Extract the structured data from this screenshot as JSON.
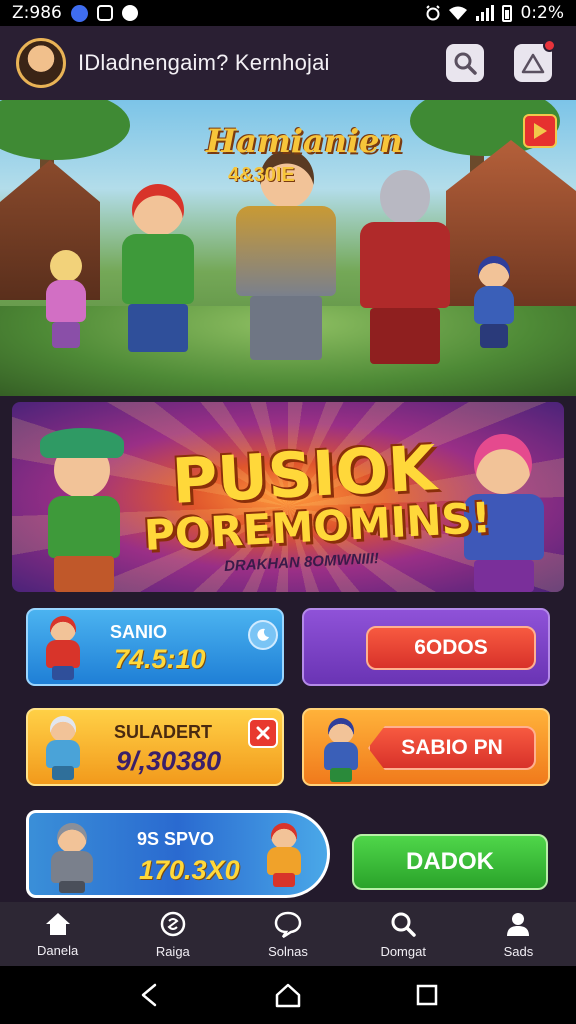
{
  "status_bar": {
    "time": "Z:986",
    "battery_text": "0:2%"
  },
  "header": {
    "title": "IDladnengaim? Kernhojai",
    "search_icon": "search-icon",
    "notification_icon": "triangle-alert-icon"
  },
  "hero": {
    "title": "Hamianien",
    "subtitle": "4&30IE",
    "play_icon": "play-icon"
  },
  "promo": {
    "title_line1": "PUSIOK",
    "title_line2": "POREMOMINS!",
    "subtitle": "DRAKHAN 8OMWNIII!"
  },
  "cards": {
    "c1": {
      "label": "SANIO",
      "value": "74.5:10"
    },
    "c2": {
      "button": "6ODOS"
    },
    "c3": {
      "label": "SULADERT",
      "value": "9/,30380"
    },
    "c4": {
      "button": "SABIO PN"
    },
    "c5": {
      "label": "9S SPVO",
      "value": "170.3X0"
    },
    "c6": {
      "button": "DADOK"
    }
  },
  "nav": [
    {
      "label": "Danela",
      "icon": "home-icon"
    },
    {
      "label": "Raiga",
      "icon": "coin-icon"
    },
    {
      "label": "Solnas",
      "icon": "chat-bubble-icon"
    },
    {
      "label": "Domgat",
      "icon": "search-icon"
    },
    {
      "label": "Sads",
      "icon": "profile-icon"
    }
  ],
  "colors": {
    "background": "#231a2c",
    "header": "#2a1f33",
    "accent_yellow": "#f7c53a",
    "blue_card": "#2a8fe0",
    "purple_card": "#7a3ec6",
    "orange_card": "#f5a623",
    "red_button": "#e8392f",
    "green_button": "#3fbf3a",
    "nav_bg": "#2d2734"
  }
}
